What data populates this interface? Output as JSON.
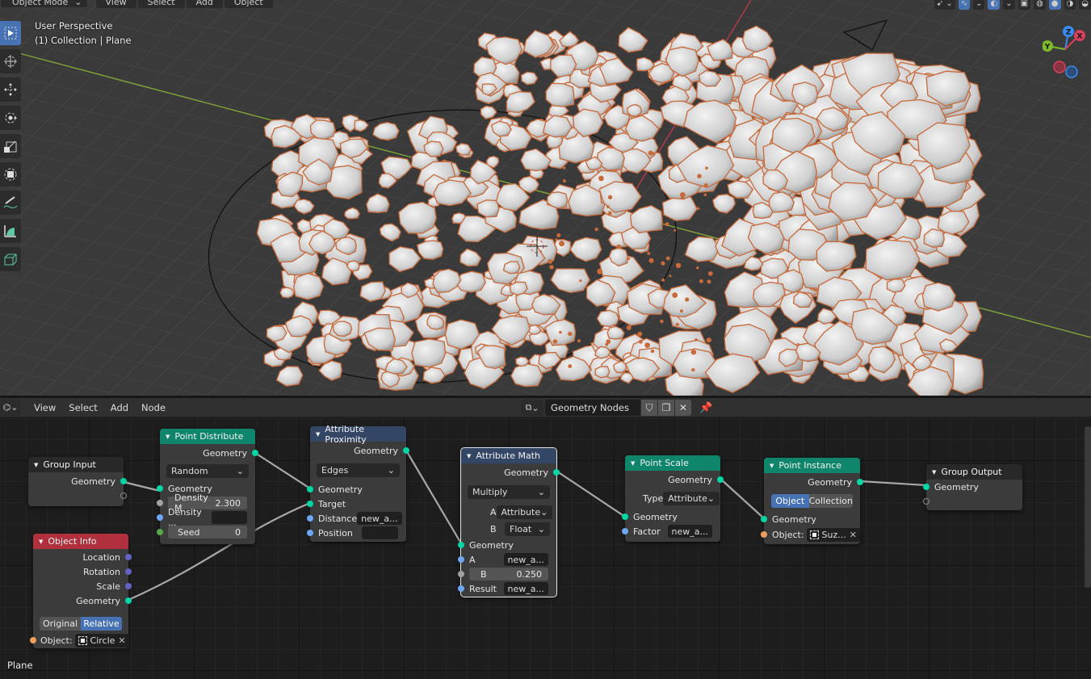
{
  "viewport": {
    "header": {
      "mode_label": "Object Mode",
      "menus": [
        "View",
        "Select",
        "Add",
        "Object"
      ]
    },
    "info": {
      "perspective": "User Perspective",
      "collection": "(1) Collection | Plane"
    },
    "tools": [
      "select-box",
      "cursor",
      "move",
      "rotate",
      "scale",
      "transform",
      "annotate",
      "measure",
      "add-cube"
    ],
    "gizmo": {
      "z": "Z",
      "y": "Y",
      "x": "X"
    },
    "colors": {
      "background": "#3a3a3a",
      "x_axis": "#b83a4a",
      "y_axis": "#7fa637",
      "selection_outline": "#c86a3a",
      "mesh": "#d8d8d8"
    }
  },
  "node_editor": {
    "header": {
      "menus": [
        "View",
        "Select",
        "Add",
        "Node"
      ],
      "tree_name": "Geometry Nodes"
    },
    "nodes": {
      "group_input": {
        "title": "Group Input",
        "outputs": [
          "Geometry"
        ]
      },
      "point_distribute": {
        "title": "Point Distribute",
        "output": "Geometry",
        "mode": "Random",
        "input_geometry": "Geometry",
        "density_label": "Density M",
        "density_value": "2.300",
        "density_attr_label": "Density ...",
        "density_attr_value": "",
        "seed_label": "Seed",
        "seed_value": "0"
      },
      "object_info": {
        "title": "Object Info",
        "outputs": [
          "Location",
          "Rotation",
          "Scale",
          "Geometry"
        ],
        "space_options": [
          "Original",
          "Relative"
        ],
        "space_selected": "Relative",
        "object_label": "Object:",
        "object_value": "Circle"
      },
      "attribute_proximity": {
        "title": "Attribute Proximity",
        "output": "Geometry",
        "mode": "Edges",
        "inputs": [
          "Geometry",
          "Target"
        ],
        "distance_label": "Distance",
        "distance_value": "new_a...",
        "position_label": "Position",
        "position_value": ""
      },
      "attribute_math": {
        "title": "Attribute Math",
        "output": "Geometry",
        "operation": "Multiply",
        "a_type_label": "A",
        "a_type": "Attribute",
        "b_type_label": "B",
        "b_type": "Float",
        "input_geometry": "Geometry",
        "a_label": "A",
        "a_value": "new_a...",
        "b_label": "B",
        "b_value": "0.250",
        "result_label": "Result",
        "result_value": "new_a..."
      },
      "point_scale": {
        "title": "Point Scale",
        "output": "Geometry",
        "type_label": "Type",
        "type_value": "Attribute",
        "input_geometry": "Geometry",
        "factor_label": "Factor",
        "factor_value": "new_a..."
      },
      "point_instance": {
        "title": "Point Instance",
        "output": "Geometry",
        "instance_options": [
          "Object",
          "Collection"
        ],
        "instance_selected": "Object",
        "input_geometry": "Geometry",
        "object_label": "Object:",
        "object_value": "Suz..."
      },
      "group_output": {
        "title": "Group Output",
        "inputs": [
          "Geometry"
        ]
      }
    },
    "socket_colors": {
      "geometry": "#00d6a3",
      "vector": "#6363c7",
      "attribute": "#6ea6f1",
      "float": "#a1a1a1",
      "int": "#5aa64a",
      "object": "#ed9e5c"
    },
    "header_colors": {
      "geometry": "#0f866b",
      "attribute": "#344665",
      "input": "#b0313d",
      "group": "#282828"
    }
  },
  "status_bar": {
    "active_object": "Plane"
  }
}
